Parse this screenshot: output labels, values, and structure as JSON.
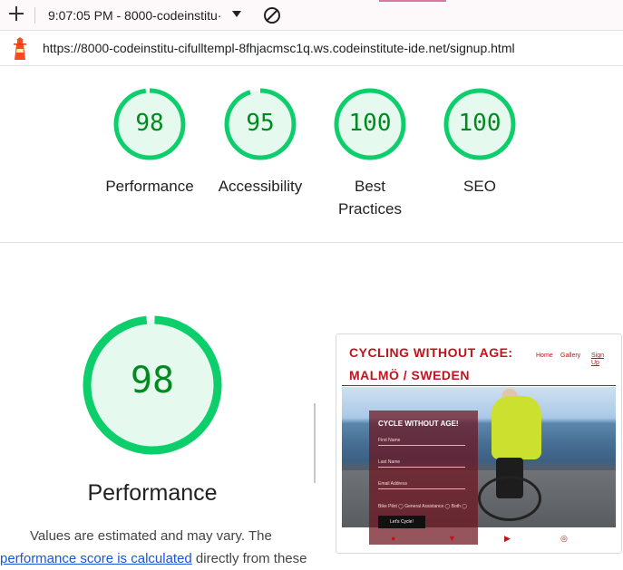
{
  "toolbar": {
    "timestamp": "9:07:05 PM - 8000-codeinstitu·",
    "new_tab_icon": "plus-icon",
    "dropdown_icon": "caret-down-icon",
    "clear_icon": "no-entry-icon"
  },
  "address": {
    "url": "https://8000-codeinstitu-cifulltempl-8fhjacmsc1q.ws.codeinstitute-ide.net/signup.html",
    "icon": "lighthouse-icon"
  },
  "scores": [
    {
      "value": 98,
      "label": "Performance"
    },
    {
      "value": 95,
      "label": "Accessibility"
    },
    {
      "value": 100,
      "label": "Best Practices"
    },
    {
      "value": 100,
      "label": "SEO"
    }
  ],
  "performance": {
    "score": 98,
    "title": "Performance",
    "note_line1": "Values are estimated and may vary. The",
    "note_link": "performance score is calculated",
    "note_after_link": " directly from these"
  },
  "colors": {
    "pass_green": "#0cce6b",
    "pass_text": "#008a1f",
    "pass_fill": "#e6f9ef",
    "link": "#1a55d8",
    "site_red": "#c3121b"
  },
  "screenshot": {
    "title_line1": "CYCLING WITHOUT AGE:",
    "title_line2": "MALMÖ / SWEDEN",
    "nav_home": "Home",
    "nav_gallery": "Gallery",
    "nav_signup_1": "Sign",
    "nav_signup_2": "Up",
    "form_title": "CYCLE WITHOUT AGE!",
    "field_first": "First Name",
    "field_last": "Last Name",
    "field_email": "Email Address",
    "radio_row": "Bike Pilot ◯ General Assistance ◯ Both ◯",
    "submit": "Let's Cycle!",
    "social_icons": [
      "facebook-icon",
      "twitter-icon",
      "youtube-icon",
      "instagram-icon"
    ]
  }
}
